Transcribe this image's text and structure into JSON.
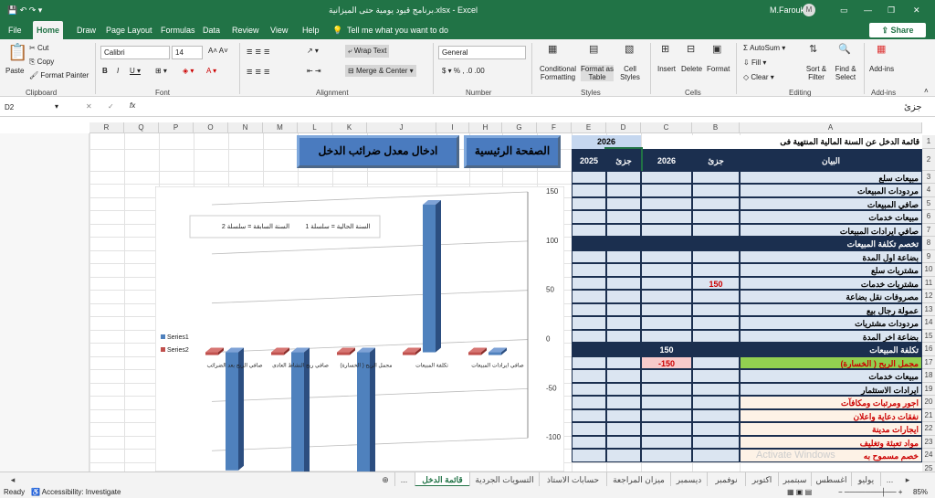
{
  "titlebar": {
    "title": "برنامج قيود يومية حتى الميزانية.xlsx - Excel",
    "user": "M.Farouk",
    "avatar": "M",
    "share": "Share"
  },
  "menu": [
    "File",
    "Home",
    "Draw",
    "Page Layout",
    "Formulas",
    "Data",
    "Review",
    "View",
    "Help"
  ],
  "tell_me": "Tell me what you want to do",
  "ribbon": {
    "paste": "Paste",
    "cut": "Cut",
    "copy": "Copy",
    "format_painter": "Format Painter",
    "clipboard": "Clipboard",
    "font_name": "Calibri",
    "font_size": "14",
    "font_group": "Font",
    "wrap_text": "Wrap Text",
    "merge_center": "Merge & Center",
    "alignment": "Alignment",
    "number_format": "General",
    "number": "Number",
    "cond_format": "Conditional Formatting",
    "format_table": "Format as Table",
    "cell_styles": "Cell Styles",
    "styles": "Styles",
    "insert": "Insert",
    "delete": "Delete",
    "format": "Format",
    "cells": "Cells",
    "autosum": "AutoSum",
    "fill": "Fill",
    "clear": "Clear",
    "sort_filter": "Sort & Filter",
    "find_select": "Find & Select",
    "editing": "Editing",
    "addins": "Add-ins",
    "addins_grp": "Add-ins"
  },
  "formula": {
    "name_box": "D2",
    "fx": "fx",
    "value": "جزئ"
  },
  "columns": [
    "A",
    "B",
    "C",
    "D",
    "E",
    "F",
    "G",
    "H",
    "I",
    "J",
    "K",
    "L",
    "M",
    "N",
    "O",
    "P",
    "Q",
    "R"
  ],
  "rows": [
    "1",
    "2",
    "3",
    "4",
    "5",
    "6",
    "7",
    "8",
    "9",
    "10",
    "11",
    "12",
    "13",
    "14",
    "15",
    "16",
    "17",
    "18",
    "19",
    "20",
    "21",
    "22",
    "23",
    "24",
    "25"
  ],
  "sheet": {
    "title": "قائمة الدخل عن السنة المالية المنتهية فى",
    "year_top": "2026",
    "header_label": "البيان",
    "h_partial1": "جزئ",
    "h_year1": "2026",
    "h_partial2": "جزئ",
    "h_year2": "2025",
    "btn_home": "الصفحة الرئيسية",
    "btn_tax": "ادخال معدل ضرائب الدخل",
    "labels": [
      "مبيعات سلع",
      "مردودات المبيعات",
      "صافي المبيعات",
      "مبيعات خدمات",
      "صافي ايرادات المبيعات",
      "تخصم تكلفة المبيعات",
      "بضاعة اول المدة",
      "مشتريات سلع",
      "مشتريات خدمات",
      "مصروفات نقل بضاعة",
      "عمولة رجال بيع",
      "مردودات مشتريات",
      "بضاعة اخر المدة",
      "تكلفة المبيعات",
      "مجمل الربح ( الخسارة)",
      "مبيعات خدمات",
      "ايرادات الاستثمار",
      "اجور ومرتبات ومكافآت",
      "نفقات دعاية واعلان",
      "ايجارات مدينة",
      "مواد تعبئة وتغليف",
      "خصم مسموح به"
    ],
    "val_b12": "150",
    "val_c17": "150",
    "val_c18": "-150"
  },
  "chart": {
    "legend_note_1": "السنة الحالية = سلسلة 1",
    "legend_note_2": "السنة السابقة = سلسلة 2",
    "series_labels": [
      "Series1",
      "Series2"
    ],
    "y_ticks": [
      "150",
      "100",
      "50",
      "0",
      "-50",
      "-100"
    ],
    "categories": [
      "صافي ايرادات المبيعات",
      "تكلفة المبيعات",
      "مجمل الربح ( الخسارة)",
      "صافي ربح النشاط العادى",
      "صافي الربح بعد الضرائب"
    ]
  },
  "chart_data": {
    "type": "bar",
    "categories": [
      "صافي ايرادات المبيعات",
      "تكلفة المبيعات",
      "مجمل الربح ( الخسارة)",
      "صافي ربح النشاط العادى",
      "صافي الربح بعد الضرائب"
    ],
    "series": [
      {
        "name": "Series1",
        "values": [
          0,
          150,
          -150,
          -150,
          -120
        ]
      },
      {
        "name": "Series2",
        "values": [
          0,
          0,
          0,
          0,
          0
        ]
      }
    ],
    "ylim": [
      -100,
      150
    ],
    "colors": [
      "#4f81bd",
      "#c0504d"
    ]
  },
  "tabs": [
    "قائمة الدخل",
    "التسويات الجردية",
    "حسابات الاستاذ",
    "ميزان المراجعة",
    "ديسمبر",
    "نوفمبر",
    "اكتوبر",
    "سبتمبر",
    "اغسطس",
    "يوليو"
  ],
  "tab_more": "...",
  "status": {
    "ready": "Ready",
    "accessibility": "Accessibility: Investigate",
    "zoom": "85%"
  },
  "watermark": "Activate Windows"
}
